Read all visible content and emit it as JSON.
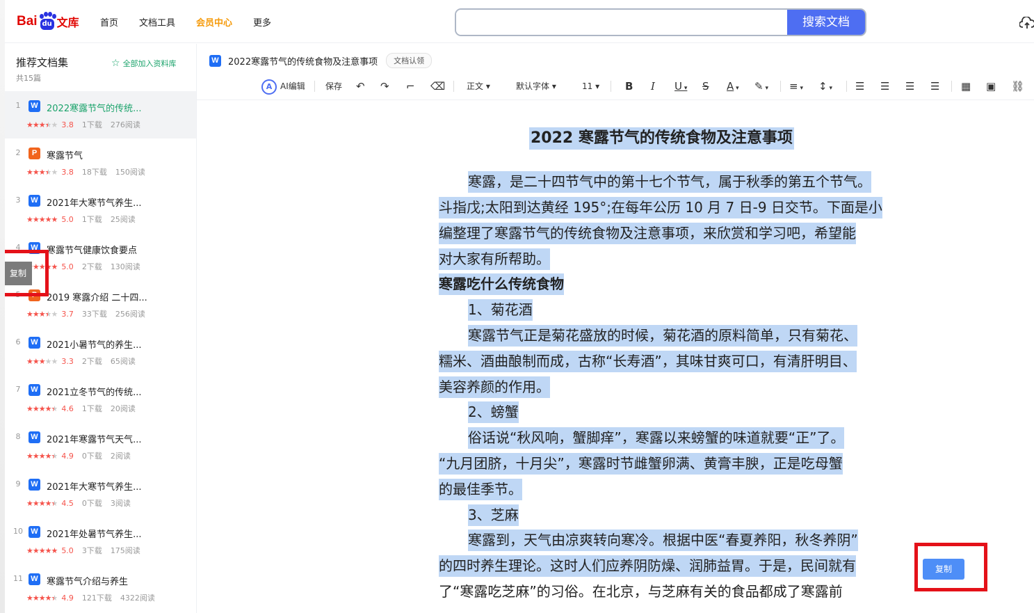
{
  "header": {
    "logo_bai": "Bai",
    "logo_du": "du",
    "logo_wenku": "文库",
    "nav": [
      "首页",
      "文档工具",
      "会员中心",
      "更多"
    ],
    "search_placeholder": "",
    "search_button": "搜索文档"
  },
  "sidebar": {
    "title": "推荐文档集",
    "count": "共15篇",
    "add_all": "全部加入资料库",
    "items": [
      {
        "num": "1",
        "type": "W",
        "name": "2022寒露节气的传统...",
        "rating": 3.8,
        "score": "3.8",
        "downloads": "1下载",
        "reads": "276阅读",
        "active": true
      },
      {
        "num": "2",
        "type": "P",
        "name": "寒露节气",
        "rating": 3.8,
        "score": "3.8",
        "downloads": "18下载",
        "reads": "150阅读"
      },
      {
        "num": "3",
        "type": "W",
        "name": "2021年大寒节气养生...",
        "rating": 5.0,
        "score": "5.0",
        "downloads": "1下载",
        "reads": "25阅读"
      },
      {
        "num": "4",
        "type": "W",
        "name": "寒露节气健康饮食要点",
        "rating": 5.0,
        "score": "5.0",
        "downloads": "2下载",
        "reads": "130阅读"
      },
      {
        "num": "5",
        "type": "P",
        "name": "2019 寒露介绍 二十四...",
        "rating": 3.7,
        "score": "3.7",
        "downloads": "33下载",
        "reads": "256阅读"
      },
      {
        "num": "6",
        "type": "W",
        "name": "2021小暑节气的养生...",
        "rating": 3.3,
        "score": "3.3",
        "downloads": "2下载",
        "reads": "65阅读"
      },
      {
        "num": "7",
        "type": "W",
        "name": "2021立冬节气的传统...",
        "rating": 4.6,
        "score": "4.6",
        "downloads": "1下载",
        "reads": "20阅读"
      },
      {
        "num": "8",
        "type": "W",
        "name": "2021年寒露节气天气...",
        "rating": 4.9,
        "score": "4.9",
        "downloads": "0下载",
        "reads": "2阅读"
      },
      {
        "num": "9",
        "type": "W",
        "name": "2021年大寒节气养生...",
        "rating": 4.5,
        "score": "4.5",
        "downloads": "0下载",
        "reads": "3阅读"
      },
      {
        "num": "10",
        "type": "W",
        "name": "2021年处暑节气养生...",
        "rating": 5.0,
        "score": "5.0",
        "downloads": "3下载",
        "reads": "175阅读"
      },
      {
        "num": "11",
        "type": "W",
        "name": "寒露节气介绍与养生",
        "rating": 4.9,
        "score": "4.9",
        "downloads": "121下载",
        "reads": "4322阅读"
      }
    ]
  },
  "doc": {
    "file_type": "W",
    "title": "2022寒露节气的传统食物及注意事项",
    "claim": "文档认领",
    "heading": "2022 寒露节气的传统食物及注意事项",
    "lines": [
      "寒露，是二十四节气中的第十七个节气，属于秋季的第五个节气。",
      "斗指戊;太阳到达黄经 195°;在每年公历 10 月 7 日-9 日交节。下面是小",
      "编整理了寒露节气的传统食物及注意事项，来欣赏和学习吧，希望能",
      "对大家有所帮助。",
      "寒露吃什么传统食物",
      "1、菊花酒",
      "寒露节气正是菊花盛放的时候，菊花酒的原料简单，只有菊花、",
      "糯米、酒曲酿制而成，古称“长寿酒”，其味甘爽可口，有清肝明目、",
      "美容养颜的作用。",
      "2、螃蟹",
      "俗话说“秋风响，蟹脚痒”，寒露以来螃蟹的味道就要“正”了。",
      "“九月团脐，十月尖”，寒露时节雌蟹卵满、黄膏丰腴，正是吃母蟹",
      "的最佳季节。",
      "3、芝麻",
      "寒露到，天气由凉爽转向寒冷。根据中医“春夏养阳，秋冬养阴”",
      "的四时养生理论。这时人们应养阴防燥、润肺益胃。于是，民间就有",
      "了“寒露吃芝麻”的习俗。在北京，与芝麻有关的食品都成了寒露前"
    ]
  },
  "toolbar": {
    "ai_logo": "A",
    "ai_edit": "AI编辑",
    "save": "保存",
    "undo": "↶",
    "redo": "↷",
    "format_painter": "⌐",
    "eraser": "⌫",
    "style": "正文",
    "font": "默认字体",
    "size": "11",
    "bold": "B",
    "italic": "I",
    "underline": "U",
    "strike": "S",
    "font_color": "A",
    "highlight": "✎",
    "align": "≡",
    "line_height": "↕",
    "ordered_list": "☰",
    "bullet_list": "☰",
    "indent": "☰",
    "outdent": "☰",
    "table": "▦",
    "image": "▣",
    "link": "⛓"
  },
  "copy_button": "复制",
  "copy_float": "复制",
  "colors": {
    "brand_blue": "#4e6ef2",
    "accent_green": "#1ba36b",
    "vip_orange": "#f59a0a",
    "rating_red": "#f5534b",
    "selection": "#bfd7f5",
    "annotation_red": "#e41119"
  }
}
